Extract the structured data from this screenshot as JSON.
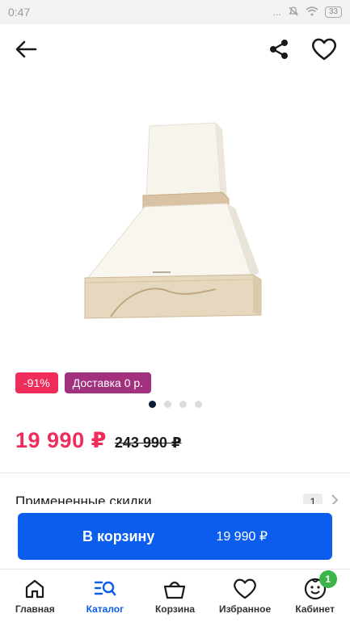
{
  "status_bar": {
    "time": "0:47",
    "signal": "...",
    "battery": "33"
  },
  "app_bar": {
    "back_icon": "arrow-left-icon",
    "share_icon": "share-icon",
    "favorite_icon": "heart-icon"
  },
  "product": {
    "image_icon": "cooker-hood-image"
  },
  "badges": {
    "discount": "-91%",
    "delivery": "Доставка 0 р."
  },
  "pager": {
    "count": 4,
    "active_index": 0
  },
  "price": {
    "current": "19 990 ₽",
    "old": "243 990 ₽"
  },
  "discounts": {
    "label": "Примененные скидки",
    "count": "1"
  },
  "cart": {
    "button_label": "В корзину",
    "button_price": "19 990 ₽"
  },
  "nav": {
    "items": [
      {
        "label": "Главная",
        "icon": "home-icon"
      },
      {
        "label": "Каталог",
        "icon": "catalog-search-icon"
      },
      {
        "label": "Корзина",
        "icon": "basket-icon"
      },
      {
        "label": "Избранное",
        "icon": "heart-icon"
      },
      {
        "label": "Кабинет",
        "icon": "smile-face-icon",
        "badge": "1"
      }
    ],
    "active": "Каталог"
  },
  "colors": {
    "accent": "#0a5ded",
    "sale": "#f02d5a",
    "delivery_badge": "#a1317d",
    "success_badge": "#3ab54a"
  }
}
